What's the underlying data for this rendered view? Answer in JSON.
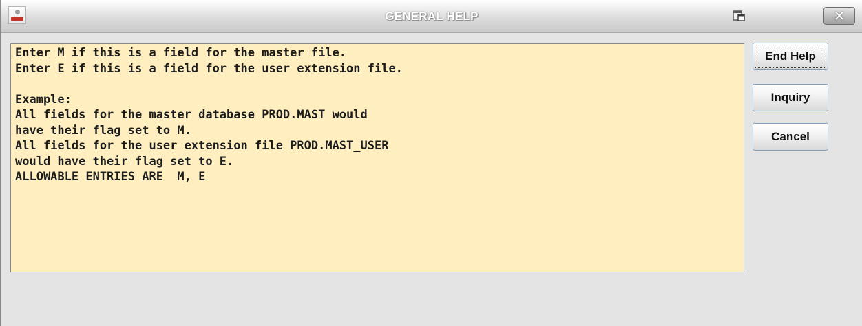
{
  "window": {
    "title": "GENERAL HELP",
    "icons": {
      "app": "app-logo-icon",
      "restore": "restore-window-icon",
      "close": "close-icon"
    },
    "close_label": "✕"
  },
  "help": {
    "lines": [
      "Enter M if this is a field for the master file.",
      "Enter E if this is a field for the user extension file.",
      "",
      "Example:",
      "All fields for the master database PROD.MAST would",
      "have their flag set to M.",
      "All fields for the user extension file PROD.MAST_USER",
      "would have their flag set to E.",
      "ALLOWABLE ENTRIES ARE  M, E"
    ]
  },
  "buttons": {
    "end_help": "End Help",
    "inquiry": "Inquiry",
    "cancel": "Cancel"
  },
  "colors": {
    "help_background": "#ffefc0",
    "window_background": "#e4e4e4"
  }
}
